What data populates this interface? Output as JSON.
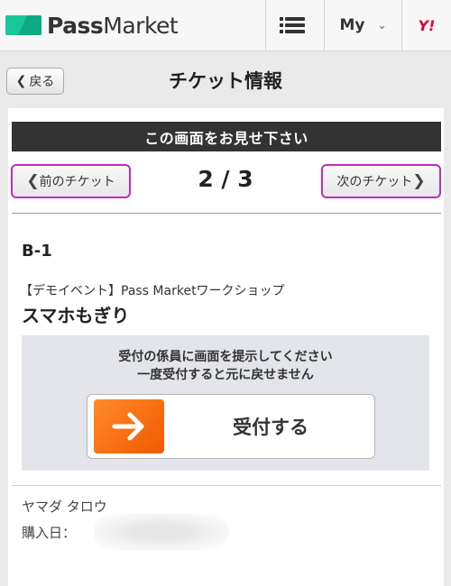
{
  "header": {
    "logo_bold": "Pass",
    "logo_thin": "Market",
    "my_label": "My",
    "yahoo_label": "Y!"
  },
  "nav": {
    "back_label": "戻る",
    "page_title": "チケット情報"
  },
  "ticket": {
    "banner": "この画面をお見せ下さい",
    "prev_label": "前のチケット",
    "next_label": "次のチケット",
    "counter": "2 / 3",
    "seat": "B-1",
    "event_name": "【デモイベント】Pass Marketワークショップ",
    "ticket_type": "スマホもぎり",
    "notice_line1": "受付の係員に画面を提示してください",
    "notice_line2": "一度受付すると元に戻せません",
    "accept_label": "受付する",
    "holder_name": "ヤマダ タロウ",
    "purchase_label": "購入日："
  },
  "colors": {
    "brand": "#19c79b",
    "banner": "#333333",
    "highlight_border": "#c229c4",
    "accept_arrow": "#f05a00"
  },
  "icons": {
    "menu": "list-menu-icon",
    "dropdown": "chevron-down-icon",
    "accept": "arrow-right-icon"
  }
}
